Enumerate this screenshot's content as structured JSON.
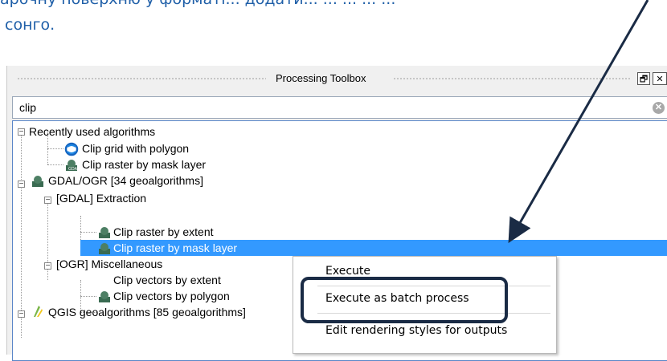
{
  "doc": {
    "line1": "арочну поверхню у форматі... додати... ... ... ... ...",
    "line2": "сонго."
  },
  "panel": {
    "title": "Processing Toolbox",
    "float_symbol": "🗗",
    "close_symbol": "✕"
  },
  "search": {
    "value": "clip",
    "clear_symbol": "✕"
  },
  "tree": {
    "recent": "Recently used algorithms",
    "recent_1": "Clip grid with polygon",
    "recent_2": "Clip raster by mask layer",
    "gdal": "GDAL/OGR [34 geoalgorithms]",
    "gdal_extraction": "[GDAL] Extraction",
    "ext_1": "Clip raster by extent",
    "ext_2": "Clip raster by mask layer",
    "ogr_misc": "[OGR] Miscellaneous",
    "misc_1": "Clip vectors by extent",
    "misc_2": "Clip vectors by polygon",
    "qgis": "QGIS geoalgorithms [85 geoalgorithms]"
  },
  "context_menu": {
    "execute": "Execute",
    "batch": "Execute as batch process",
    "edit_styles": "Edit rendering styles for outputs"
  },
  "colors": {
    "selection": "#3399ff",
    "arrow": "#1a2b45",
    "doc_text": "#1f5fa8"
  }
}
